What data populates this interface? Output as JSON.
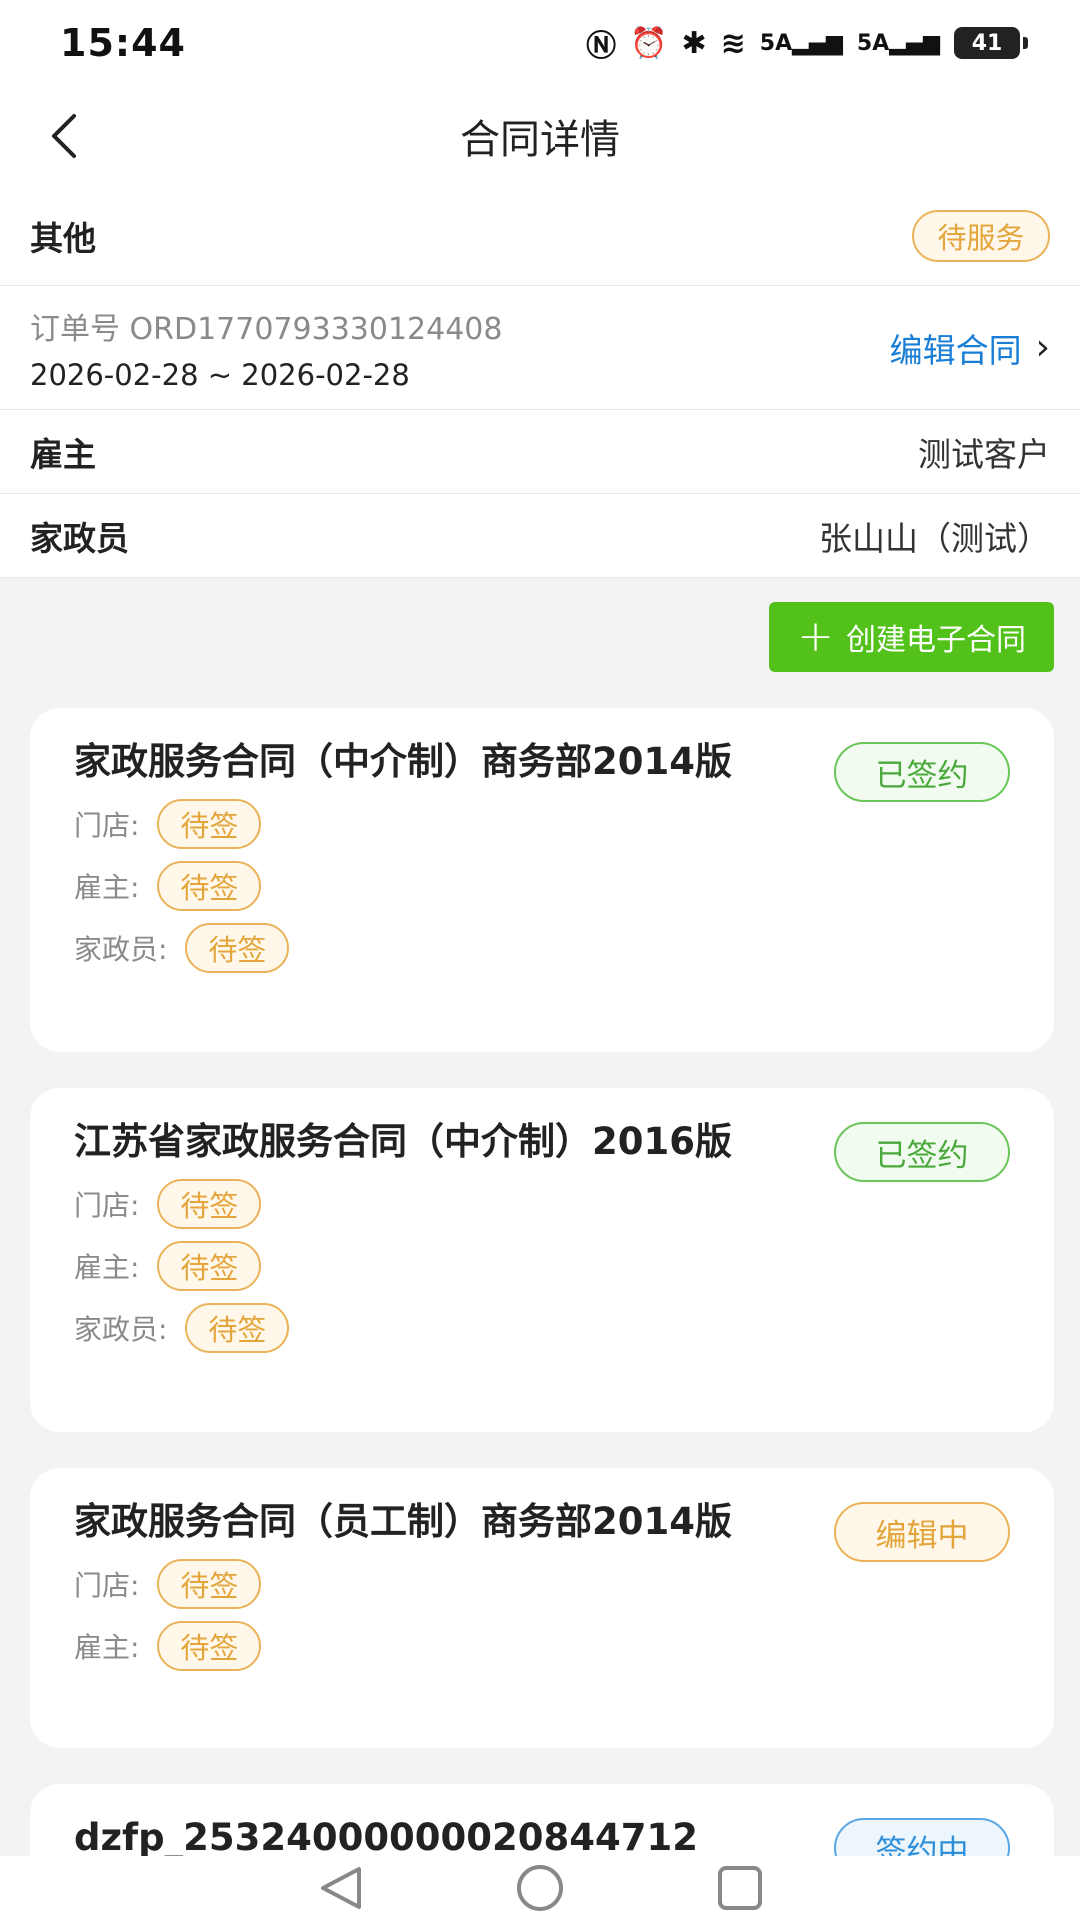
{
  "status_bar": {
    "time": "15:44",
    "signal_1": "5A",
    "signal_2": "5A",
    "battery": "41"
  },
  "nav": {
    "title": "合同详情"
  },
  "header": {
    "category": "其他",
    "status": "待服务"
  },
  "order": {
    "number": "订单号 ORD1770793330124408",
    "dates": "2026-02-28 ~ 2026-02-28",
    "edit_label": "编辑合同"
  },
  "employer": {
    "label": "雇主",
    "value": "测试客户"
  },
  "worker": {
    "label": "家政员",
    "value": "张山山（测试）"
  },
  "create_button": "创建电子合同",
  "contracts": [
    {
      "title": "家政服务合同（中介制）商务部2014版",
      "status": "已签约",
      "signers": [
        {
          "label": "门店:",
          "status": "待签"
        },
        {
          "label": "雇主:",
          "status": "待签"
        },
        {
          "label": "家政员:",
          "status": "待签"
        }
      ]
    },
    {
      "title": "江苏省家政服务合同（中介制）2016版",
      "status": "已签约",
      "signers": [
        {
          "label": "门店:",
          "status": "待签"
        },
        {
          "label": "雇主:",
          "status": "待签"
        },
        {
          "label": "家政员:",
          "status": "待签"
        }
      ]
    },
    {
      "title": "家政服务合同（员工制）商务部2014版",
      "status": "编辑中",
      "signers": [
        {
          "label": "门店:",
          "status": "待签"
        },
        {
          "label": "雇主:",
          "status": "待签"
        }
      ]
    },
    {
      "title": "dzfp_25324000000020844712",
      "status": "签约中"
    }
  ],
  "colors": {
    "accent_green": "#52c21a",
    "link_blue": "#1a7ed6",
    "pending_orange": "#e3a53c"
  },
  "icons": [
    "back-chevron-icon",
    "plus-icon",
    "nav-back-icon",
    "nav-home-icon",
    "nav-recents-icon"
  ]
}
